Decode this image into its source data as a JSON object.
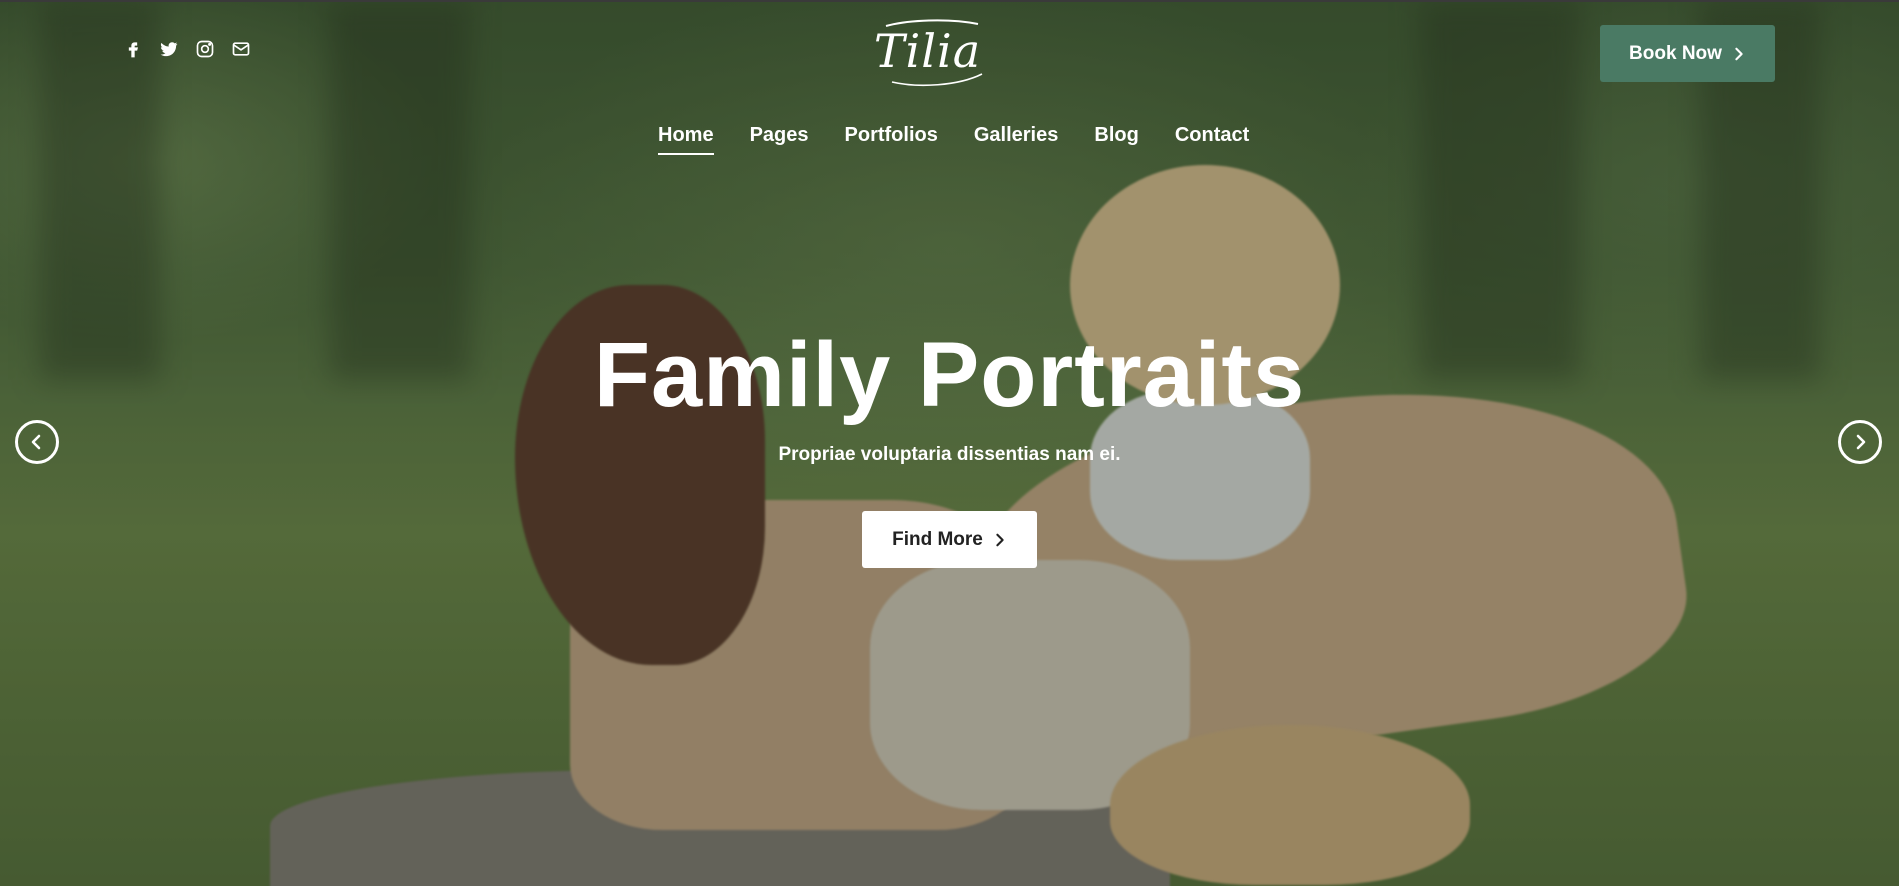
{
  "header": {
    "social_icons": [
      "facebook-icon",
      "twitter-icon",
      "instagram-icon",
      "envelope-icon"
    ],
    "logo_text": "Tilia",
    "book_button_label": "Book Now"
  },
  "nav": {
    "items": [
      {
        "label": "Home",
        "active": true
      },
      {
        "label": "Pages",
        "active": false
      },
      {
        "label": "Portfolios",
        "active": false
      },
      {
        "label": "Galleries",
        "active": false
      },
      {
        "label": "Blog",
        "active": false
      },
      {
        "label": "Contact",
        "active": false
      }
    ]
  },
  "hero": {
    "title": "Family Portraits",
    "subtitle": "Propriae voluptaria dissentias nam ei.",
    "cta_label": "Find More",
    "prev_icon": "chevron-left-icon",
    "next_icon": "chevron-right-icon"
  },
  "colors": {
    "accent": "#4a7a64",
    "text_light": "#ffffff"
  }
}
